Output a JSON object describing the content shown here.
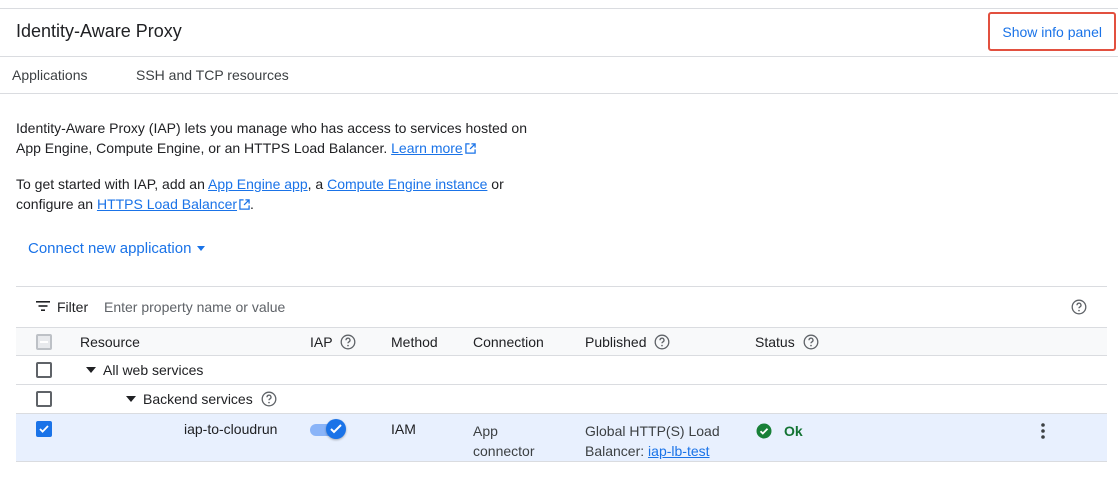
{
  "header": {
    "title": "Identity-Aware Proxy",
    "info_panel_button": "Show info panel"
  },
  "tabs": [
    {
      "label": "Applications"
    },
    {
      "label": "SSH and TCP resources"
    }
  ],
  "intro": {
    "line1_prefix": "Identity-Aware Proxy (IAP) lets you manage who has access to services hosted on",
    "line2_prefix": "App Engine, Compute Engine, or an HTTPS Load Balancer. ",
    "learn_more": "Learn more",
    "start_prefix": "To get started with IAP, add an ",
    "app_engine_link": "App Engine app",
    "comma": ", a ",
    "compute_link": "Compute Engine instance",
    "or_text": " or",
    "configure_text": "configure an ",
    "lb_link": "HTTPS Load Balancer",
    "period": "."
  },
  "connect_button": "Connect new application",
  "filter": {
    "label": "Filter",
    "placeholder": "Enter property name or value"
  },
  "table": {
    "columns": [
      "Resource",
      "IAP",
      "Method",
      "Connection",
      "Published",
      "Status"
    ],
    "group_all": "All web services",
    "group_backend": "Backend services",
    "row": {
      "resource": "iap-to-cloudrun",
      "iap_enabled": true,
      "method": "IAM",
      "connection_line1": "App",
      "connection_line2": "connector",
      "published_line1": "Global HTTP(S) Load",
      "published_prefix": "Balancer: ",
      "published_link": "iap-lb-test",
      "status": "Ok",
      "checked": true
    }
  },
  "colors": {
    "accent": "#1a73e8",
    "status_ok": "#137333",
    "highlight_border": "#e2503f",
    "selected_row": "#e8f0fe"
  }
}
